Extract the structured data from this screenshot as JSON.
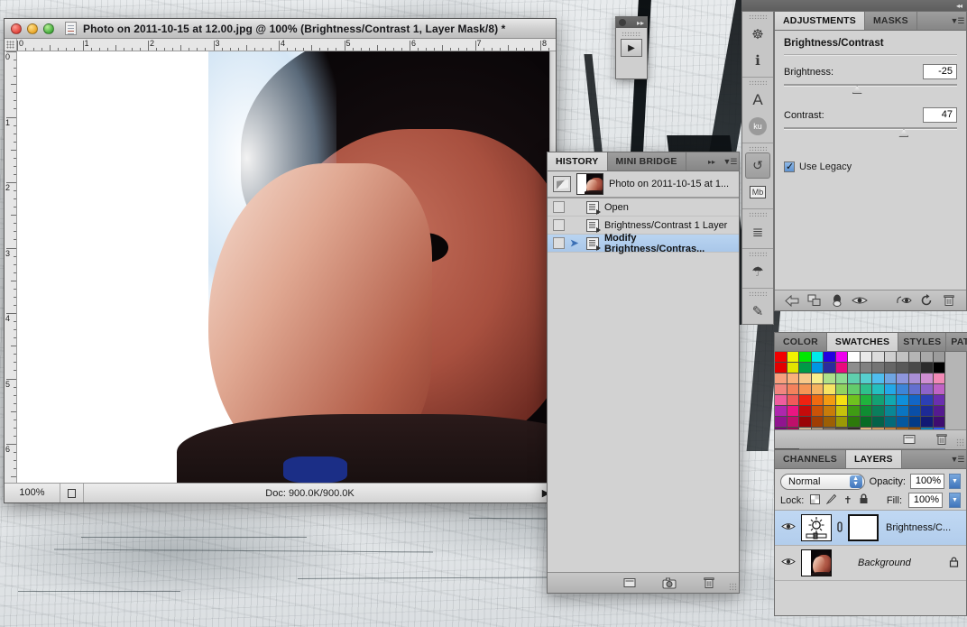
{
  "desktop": {
    "wallpaper_name": "grunge-concrete-wallpaper"
  },
  "document_window": {
    "title": "Photo on 2011-10-15 at 12.00.jpg @ 100% (Brightness/Contrast 1, Layer Mask/8) *",
    "close_label": "×",
    "minimize_label": "−",
    "zoom_label": "+",
    "doc_icon": "document-icon",
    "rulers": {
      "horizontal_labels": [
        "0",
        "1",
        "2",
        "3",
        "4",
        "5",
        "6",
        "7",
        "8"
      ],
      "vertical_labels": [
        "0",
        "1",
        "2",
        "3",
        "4",
        "5",
        "6"
      ],
      "unit": "inches"
    },
    "statusbar": {
      "zoom": "100%",
      "grip_icon": "doc-size-icon",
      "doc_info": "Doc: 900.0K/900.0K",
      "arrow": "▶"
    }
  },
  "mini_player": {
    "dot_icon": "record-dot-icon",
    "expand_icon": "▸▸",
    "play_icon": "▶"
  },
  "icon_dock": {
    "collapse_icon": "◂◂",
    "items": [
      {
        "name": "navigator-icon",
        "glyph": "☸"
      },
      {
        "name": "info-icon",
        "glyph": "ℹ"
      },
      {
        "name": "character-icon",
        "glyph": "A"
      },
      {
        "name": "kuler-icon",
        "glyph": "ku"
      },
      {
        "name": "history-icon",
        "glyph": "↺",
        "active": true
      },
      {
        "name": "mini-bridge-icon",
        "glyph": "Mb"
      },
      {
        "name": "layer-comps-icon",
        "glyph": "≣"
      },
      {
        "name": "tool-presets-icon",
        "glyph": "☂"
      },
      {
        "name": "brush-icon",
        "glyph": "✎"
      }
    ]
  },
  "adjustments_panel": {
    "tabs": [
      {
        "label": "ADJUSTMENTS",
        "active": true
      },
      {
        "label": "MASKS",
        "active": false
      }
    ],
    "menu_icon": "panel-menu-icon",
    "title": "Brightness/Contrast",
    "controls": [
      {
        "label": "Brightness:",
        "value": "-25",
        "slider_percent": 42
      },
      {
        "label": "Contrast:",
        "value": "47",
        "slider_percent": 69
      }
    ],
    "use_legacy": {
      "label": "Use Legacy",
      "checked": true
    },
    "footer_icons": [
      {
        "name": "back-arrow-icon",
        "glyph": "↩"
      },
      {
        "name": "expand-view-icon",
        "glyph": "⧉"
      },
      {
        "name": "clip-to-layer-icon",
        "glyph": "●"
      },
      {
        "name": "toggle-visibility-icon",
        "glyph": "◉"
      },
      {
        "name": "preview-previous-icon",
        "glyph": "⎌"
      },
      {
        "name": "reset-icon",
        "glyph": "↻"
      },
      {
        "name": "delete-icon",
        "glyph": "☒"
      }
    ]
  },
  "swatches_panel": {
    "tabs": [
      {
        "label": "COLOR",
        "active": false
      },
      {
        "label": "SWATCHES",
        "active": true
      },
      {
        "label": "STYLES",
        "active": false
      },
      {
        "label": "PATHS",
        "active": false
      }
    ],
    "menu_icon": "panel-menu-icon",
    "footer_icons": [
      {
        "name": "new-swatch-icon",
        "glyph": "⧉"
      },
      {
        "name": "delete-swatch-icon",
        "glyph": "☒"
      }
    ],
    "colors": [
      [
        "#f20000",
        "#f2f200",
        "#00e800",
        "#00eaea",
        "#2200e0",
        "#ee00ee",
        "#ffffff",
        "#eaeaea",
        "#dcdcdc",
        "#cfcfcf",
        "#c2c2c2",
        "#b5b5b5",
        "#a8a8a8",
        "#9b9b9b"
      ],
      [
        "#e30000",
        "#e3e300",
        "#009a46",
        "#0096e3",
        "#2b2b9c",
        "#ea0a7d",
        "#8e8e8e",
        "#818181",
        "#747474",
        "#666666",
        "#595959",
        "#4a4a4a",
        "#2b2b2b",
        "#000000"
      ],
      [
        "#f7a07e",
        "#f9b07c",
        "#f8c98a",
        "#f7ee8c",
        "#aee08a",
        "#8ddc92",
        "#5fcfae",
        "#56cfcf",
        "#4fbdee",
        "#6fa5e2",
        "#8e96dd",
        "#a98fd6",
        "#cf8fd2",
        "#f28ab6",
        "#f2857f"
      ],
      [
        "#f4815c",
        "#f59455",
        "#f6b360",
        "#f7e463",
        "#91d35f",
        "#63cc6c",
        "#2ec08c",
        "#24bfbf",
        "#23a8e8",
        "#3d85d8",
        "#6470cf",
        "#8d63c9",
        "#c063c5",
        "#ef5d9e",
        "#f05a5a"
      ],
      [
        "#ee2211",
        "#ef6a11",
        "#f29b12",
        "#f5e013",
        "#6fc21f",
        "#1fb33d",
        "#13a173",
        "#11a8b0",
        "#0f8fdb",
        "#1266c7",
        "#2c3fb5",
        "#6b2fb0",
        "#ae27ad",
        "#ea1682"
      ],
      [
        "#c50b0b",
        "#cb5208",
        "#c87c0a",
        "#c5c20b",
        "#3f9b14",
        "#0f8c32",
        "#0a7e5c",
        "#0a8795",
        "#0a75c2",
        "#0a4fa8",
        "#1d2a96",
        "#551a90",
        "#90148f",
        "#bf0f6a"
      ],
      [
        "#9a0505",
        "#a03d04",
        "#9c5f05",
        "#9a9905",
        "#2d7a0b",
        "#086b25",
        "#046249",
        "#046a78",
        "#0458a0",
        "#023b88",
        "#111a74",
        "#3f0c70",
        "#700a6f",
        "#960a52"
      ],
      [
        "#cdb694",
        "#a8957d",
        "#7c6a5a",
        "#5a4e43",
        "#332c26",
        "#e0b37a",
        "#cf9a5f",
        "#c07f3d",
        "#a3631f",
        "#8a4f0c",
        "#0a7fb5",
        "#2a59f0",
        "#1f3fdc",
        "#e8a90c"
      ]
    ]
  },
  "layers_panel": {
    "tabs": [
      {
        "label": "CHANNELS",
        "active": false
      },
      {
        "label": "LAYERS",
        "active": true
      }
    ],
    "menu_icon": "panel-menu-icon",
    "blend_mode": "Normal",
    "opacity_label": "Opacity:",
    "opacity_value": "100%",
    "lock_label": "Lock:",
    "lock_icons": [
      {
        "name": "lock-transparency-icon",
        "glyph": "⬚"
      },
      {
        "name": "lock-pixels-icon",
        "glyph": "✒"
      },
      {
        "name": "lock-position-icon",
        "glyph": "✥"
      },
      {
        "name": "lock-all-icon",
        "glyph": "🔒"
      }
    ],
    "fill_label": "Fill:",
    "fill_value": "100%",
    "rows": [
      {
        "name": "Brightness/C...",
        "thumb": "brightness-contrast-adjustment-icon",
        "has_mask": true,
        "link_icon": "link-icon",
        "eye_icon": "eye-icon",
        "selected": true,
        "italic": false,
        "locked": false
      },
      {
        "name": "Background",
        "thumb": "photo-thumbnail",
        "has_mask": false,
        "link_icon": "",
        "eye_icon": "eye-icon",
        "selected": false,
        "italic": true,
        "locked": true,
        "lock_icon": "lock-icon"
      }
    ]
  },
  "history_panel": {
    "tabs": [
      {
        "label": "HISTORY",
        "active": true
      },
      {
        "label": "MINI BRIDGE",
        "active": false
      }
    ],
    "expand_icon": "▸▸",
    "menu_icon": "panel-menu-icon",
    "snapshot": {
      "label": "Photo on 2011-10-15 at 1...",
      "icon": "snapshot-brush-icon",
      "thumb": "snapshot-thumbnail"
    },
    "states": [
      {
        "label": "Open",
        "selected": false,
        "current": false
      },
      {
        "label": "Brightness/Contrast 1 Layer",
        "selected": false,
        "current": false
      },
      {
        "label": "Modify Brightness/Contras...",
        "selected": true,
        "current": true
      }
    ],
    "footer_icons": [
      {
        "name": "new-document-from-state-icon",
        "glyph": "▤"
      },
      {
        "name": "new-snapshot-icon",
        "glyph": "📷"
      },
      {
        "name": "delete-state-icon",
        "glyph": "☒"
      }
    ]
  }
}
